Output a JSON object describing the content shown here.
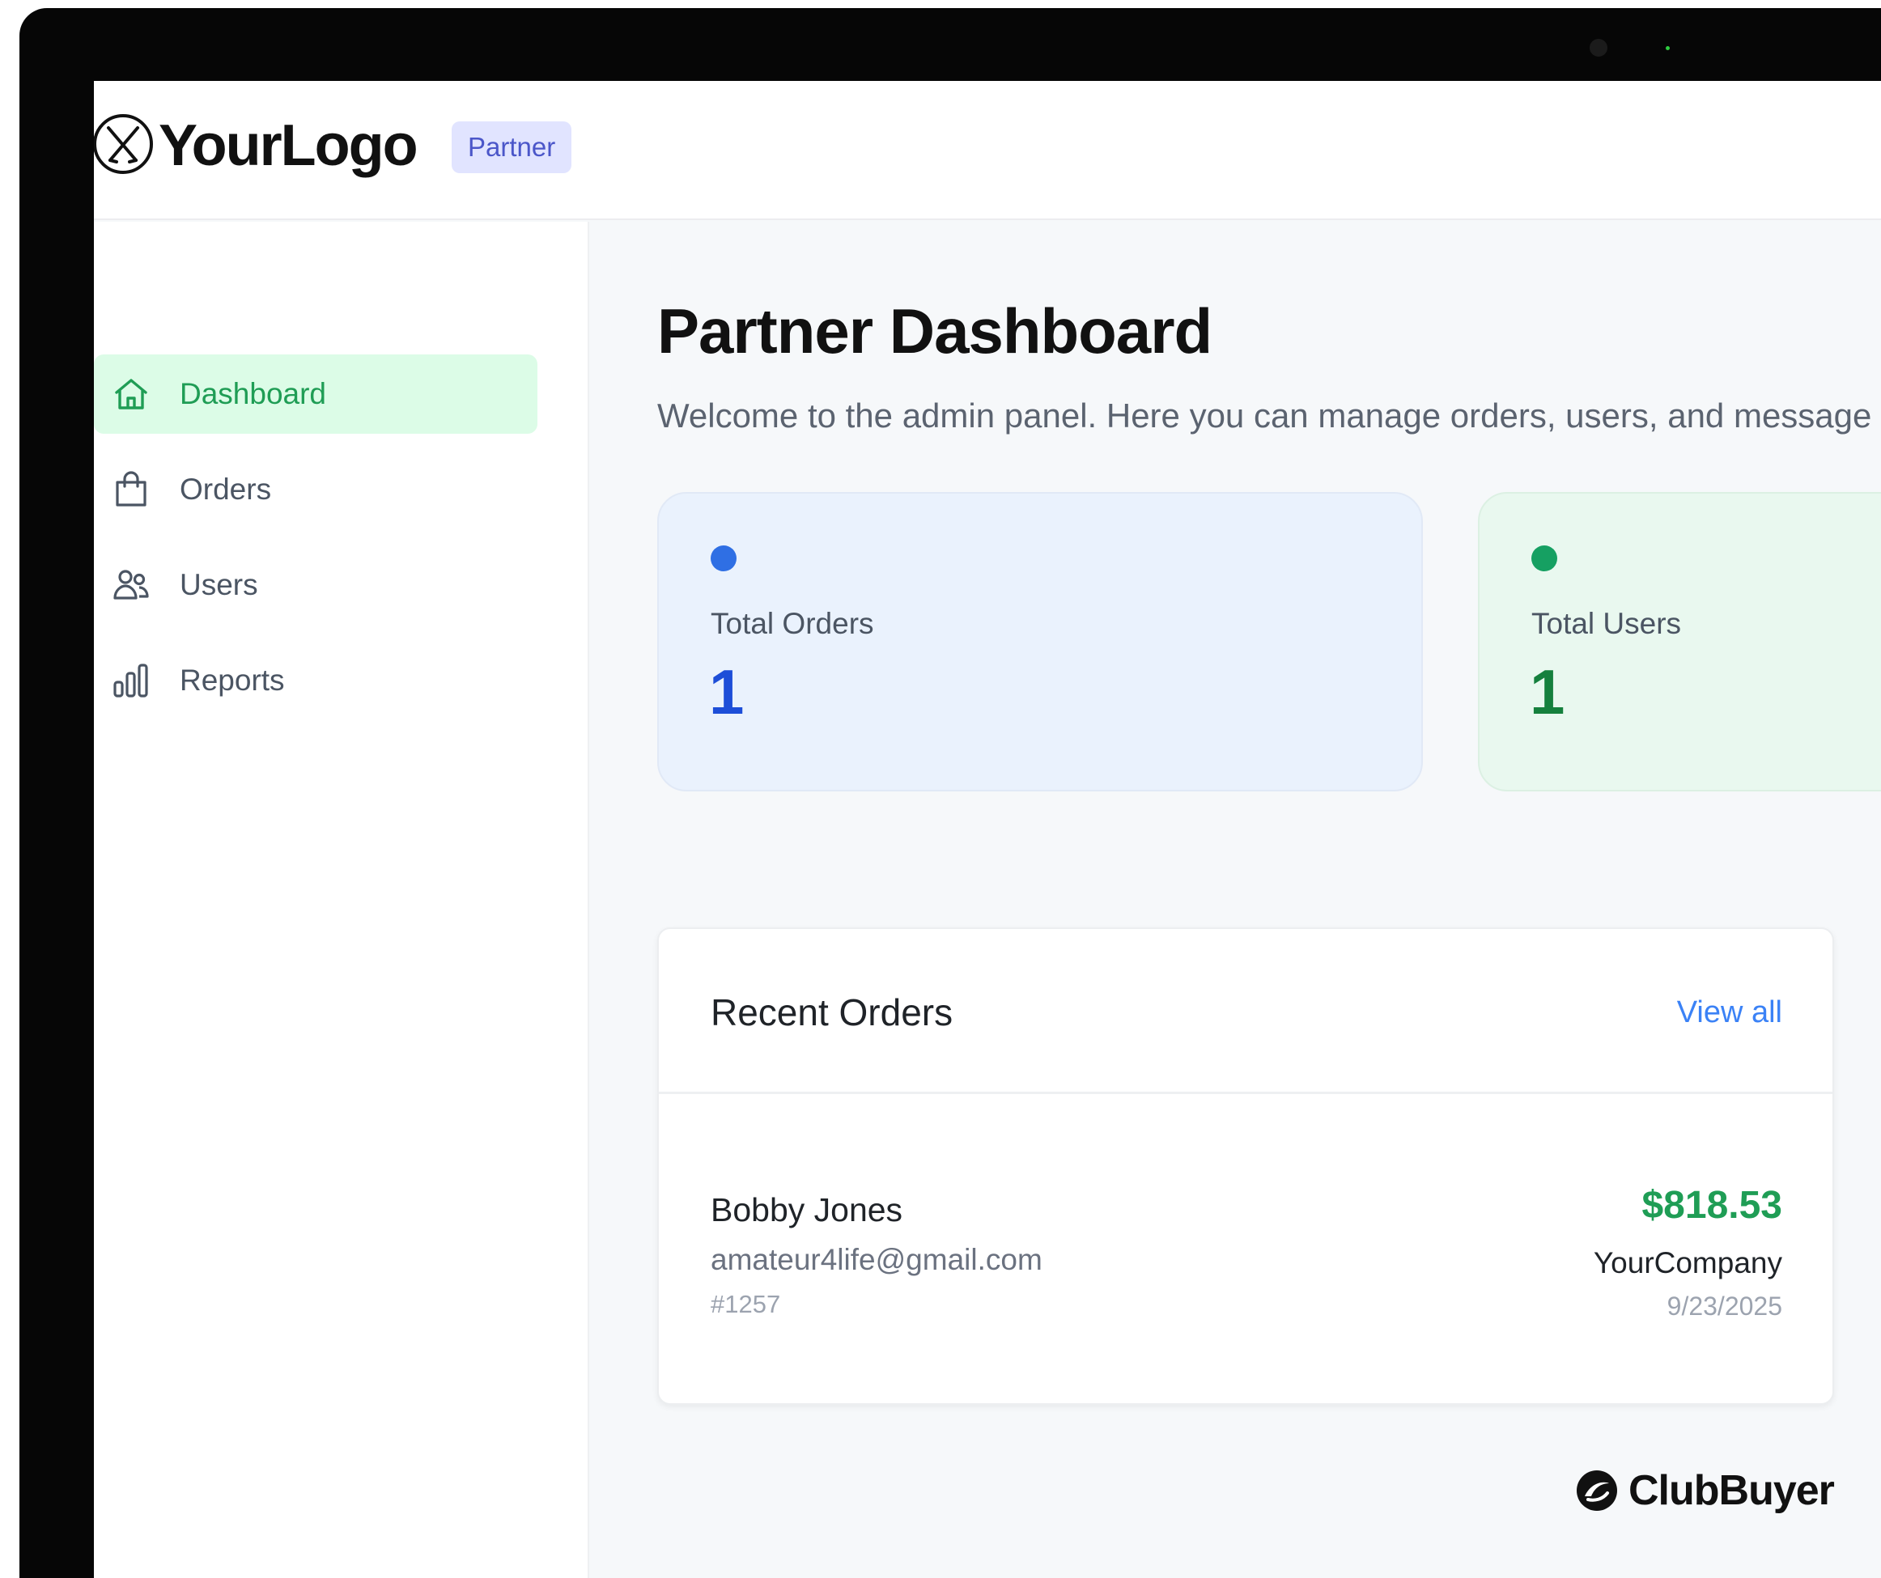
{
  "brand": {
    "logo_text": "YourLogo",
    "badge": "Partner"
  },
  "sidebar": {
    "items": [
      {
        "label": "Dashboard",
        "icon": "home-icon",
        "active": true
      },
      {
        "label": "Orders",
        "icon": "shopping-bag-icon",
        "active": false
      },
      {
        "label": "Users",
        "icon": "users-icon",
        "active": false
      },
      {
        "label": "Reports",
        "icon": "bar-chart-icon",
        "active": false
      }
    ]
  },
  "main": {
    "title": "Partner Dashboard",
    "subtitle": "Welcome to the admin panel. Here you can manage orders, users, and message",
    "stats": [
      {
        "label": "Total Orders",
        "value": "1",
        "dot_color": "#2f6fe4",
        "value_color": "#1d4ed8"
      },
      {
        "label": "Total Users",
        "value": "1",
        "dot_color": "#16a062",
        "value_color": "#15803d"
      }
    ],
    "recent_orders": {
      "title": "Recent Orders",
      "view_all": "View all",
      "orders": [
        {
          "name": "Bobby Jones",
          "email": "amateur4life@gmail.com",
          "id": "#1257",
          "amount": "$818.53",
          "company": "YourCompany",
          "date": "9/23/2025"
        }
      ]
    }
  },
  "watermark": {
    "text": "ClubBuyer"
  },
  "colors": {
    "accent_green": "#1f9d55",
    "active_bg": "#dcfce7",
    "link_blue": "#3b82f6",
    "badge_bg": "#e1e4ff"
  }
}
